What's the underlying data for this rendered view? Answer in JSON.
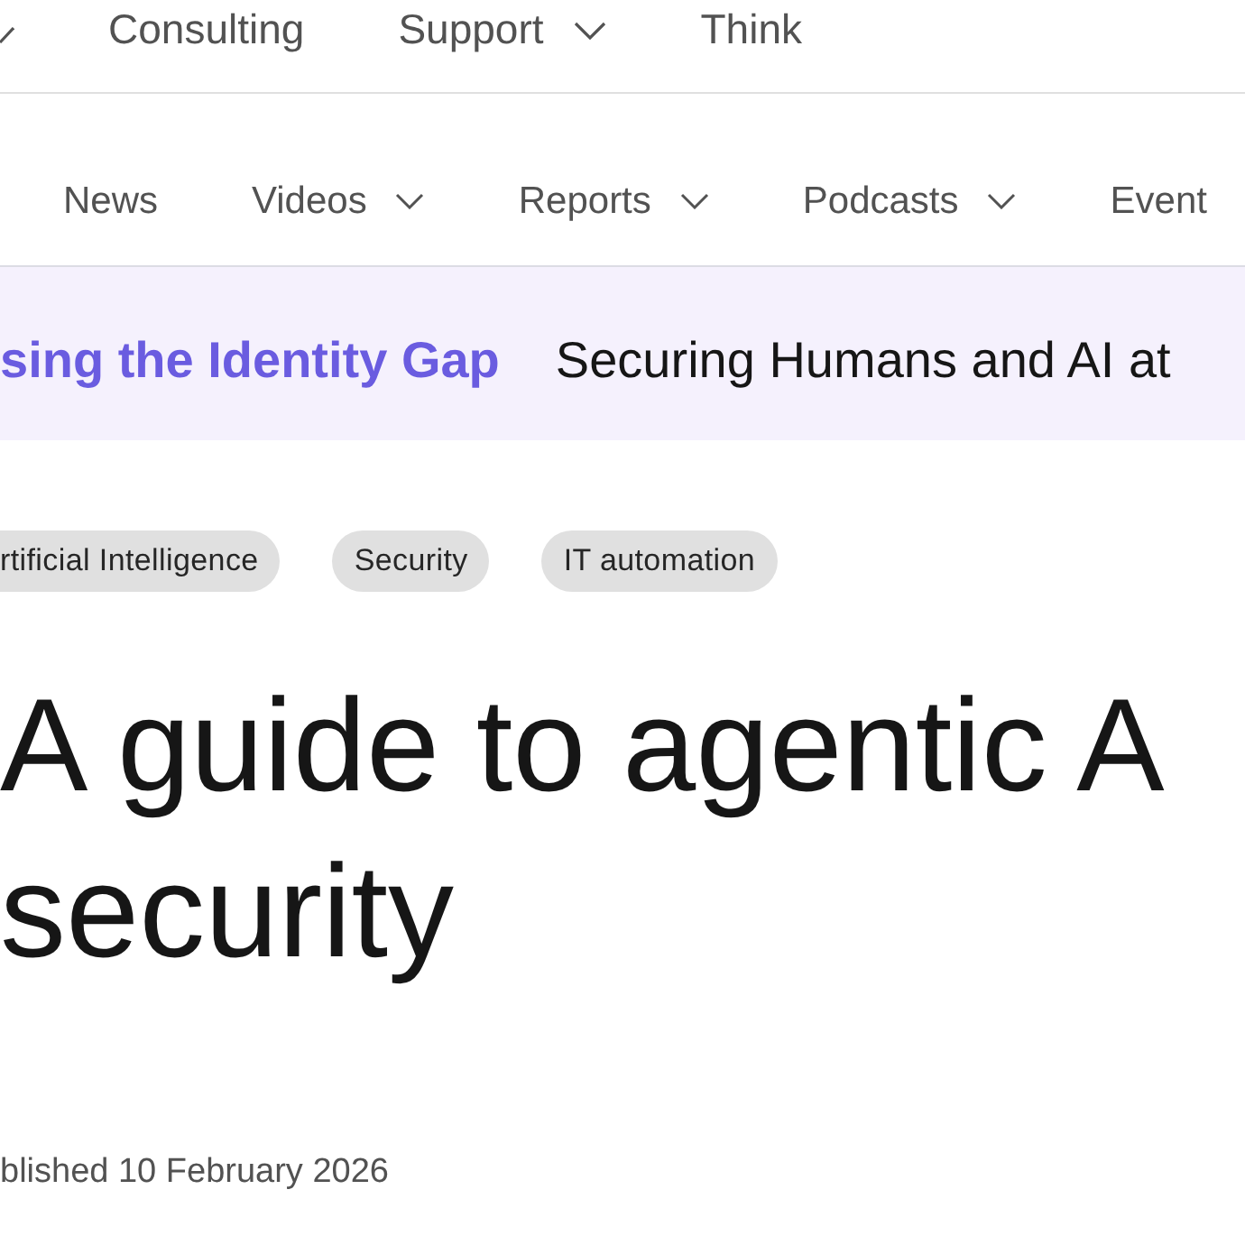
{
  "top_nav": {
    "items": [
      {
        "dropdown": true
      },
      {
        "label": "Consulting",
        "dropdown": false
      },
      {
        "label": "Support",
        "dropdown": true
      },
      {
        "label": "Think",
        "dropdown": false
      }
    ]
  },
  "sub_nav": {
    "items": [
      {
        "label": "News",
        "dropdown": false
      },
      {
        "label": "Videos",
        "dropdown": true
      },
      {
        "label": "Reports",
        "dropdown": true
      },
      {
        "label": "Podcasts",
        "dropdown": true
      },
      {
        "label": "Event",
        "dropdown": false
      }
    ]
  },
  "banner": {
    "highlight": "sing the Identity Gap",
    "text": "Securing Humans and AI at"
  },
  "tags": [
    "rtificial Intelligence",
    "Security",
    "IT automation"
  ],
  "article": {
    "title": "A guide to agentic A security",
    "published": "blished 10 February 2026"
  }
}
